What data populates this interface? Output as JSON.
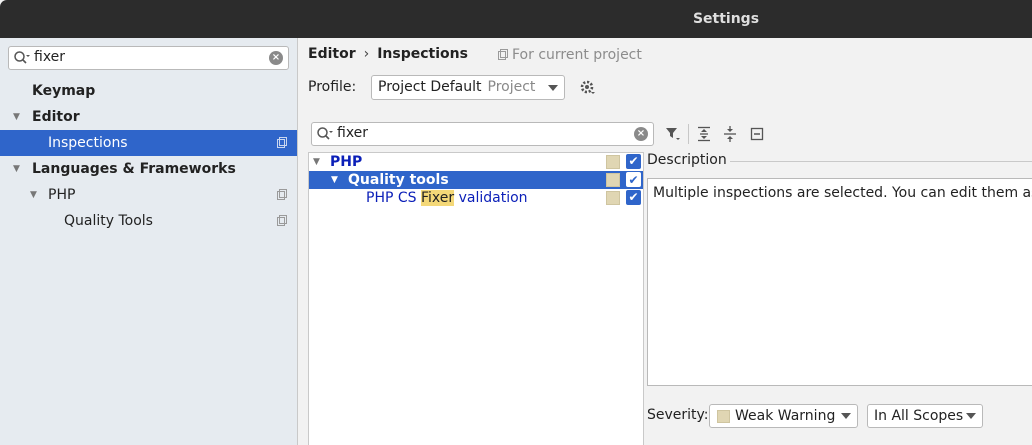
{
  "window": {
    "title": "Settings"
  },
  "sidebar": {
    "search": {
      "value": "fixer"
    },
    "items": [
      {
        "label": "Keymap"
      },
      {
        "label": "Editor"
      },
      {
        "label": "Inspections"
      },
      {
        "label": "Languages & Frameworks"
      },
      {
        "label": "PHP"
      },
      {
        "label": "Quality Tools"
      }
    ]
  },
  "main": {
    "breadcrumb": {
      "parent": "Editor",
      "separator": "›",
      "current": "Inspections"
    },
    "scope_note": "For current project",
    "profile": {
      "label": "Profile:",
      "value": "Project Default",
      "sub": "Project"
    },
    "tree_search": {
      "value": "fixer"
    },
    "tree": {
      "php": "PHP",
      "quality_tools": "Quality tools",
      "item_prefix": "PHP CS ",
      "item_highlight": "Fixer",
      "item_suffix": " validation"
    },
    "description": {
      "label": "Description",
      "text": "Multiple inspections are selected. You can edit them as a single inspection."
    },
    "severity": {
      "label": "Severity:",
      "value": "Weak Warning",
      "scope": "In All Scopes"
    }
  },
  "colors": {
    "selection": "#2f65ca",
    "weak_warning": "#e0d6b3",
    "highlight": "#f4d878"
  }
}
